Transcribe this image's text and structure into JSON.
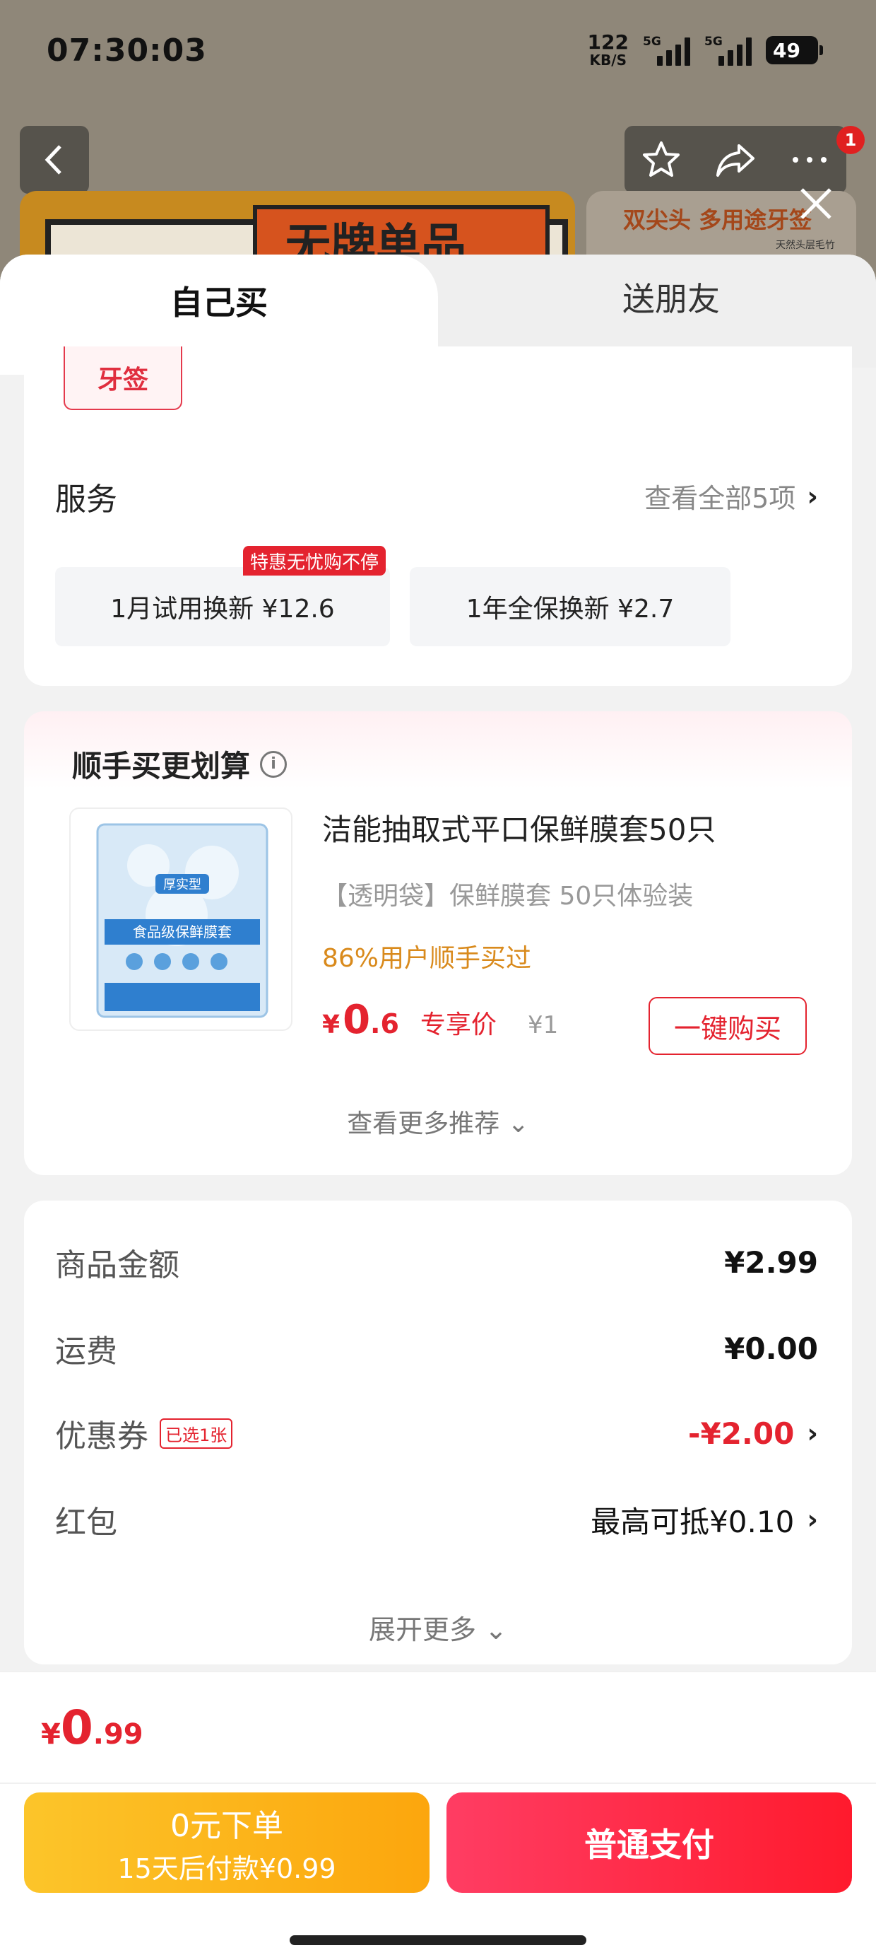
{
  "status_bar": {
    "time": "07:30:03",
    "net_speed_value": "122",
    "net_speed_unit": "KB/S",
    "signal_1": "5G",
    "signal_2": "5G",
    "battery": "49"
  },
  "background": {
    "notification_count": "1",
    "banner_left_text": "无牌单品",
    "banner_right_text": "双尖头 多用途牙签",
    "banner_right_small": "天然头层毛竹"
  },
  "tabs": [
    {
      "label": "自己买"
    },
    {
      "label": "送朋友"
    }
  ],
  "spec": {
    "selected_option": "牙签"
  },
  "services": {
    "title": "服务",
    "view_all": "查看全部5项",
    "badge": "特惠无忧购不停",
    "options": [
      {
        "label": "1月试用换新  ¥12.6"
      },
      {
        "label": "1年全保换新  ¥2.7"
      }
    ]
  },
  "recommend": {
    "title": "顺手买更划算",
    "product": {
      "name": "洁能抽取式平口保鲜膜套50只",
      "spec": "【透明袋】保鲜膜套 50只体验装",
      "social": "86%用户顺手买过",
      "price_symbol": "¥",
      "price_int": "0",
      "price_dec": ".6",
      "price_tag": "专享价",
      "original_price": "¥1",
      "buy_label": "一键购买",
      "image_text_1": "厚实型",
      "image_text_2": "食品级保鲜膜套"
    },
    "more": "查看更多推荐 ⌄"
  },
  "summary": {
    "rows": [
      {
        "label": "商品金额",
        "value": "¥2.99"
      },
      {
        "label": "运费",
        "value": "¥0.00"
      },
      {
        "label": "优惠券",
        "badge": "已选1张",
        "value": "-¥2.00"
      },
      {
        "label": "红包",
        "value": "最高可抵¥0.10"
      }
    ],
    "expand": "展开更多 ⌄"
  },
  "bottom": {
    "total_symbol": "¥",
    "total_int": "0",
    "total_dec": ".99",
    "zero_line1": "0元下单",
    "zero_line2": "15天后付款¥0.99",
    "pay_label": "普通支付"
  },
  "colors": {
    "accent_red": "#e4232f",
    "orange_button": "#fca60d",
    "pay_button": "#ff1a2d"
  }
}
